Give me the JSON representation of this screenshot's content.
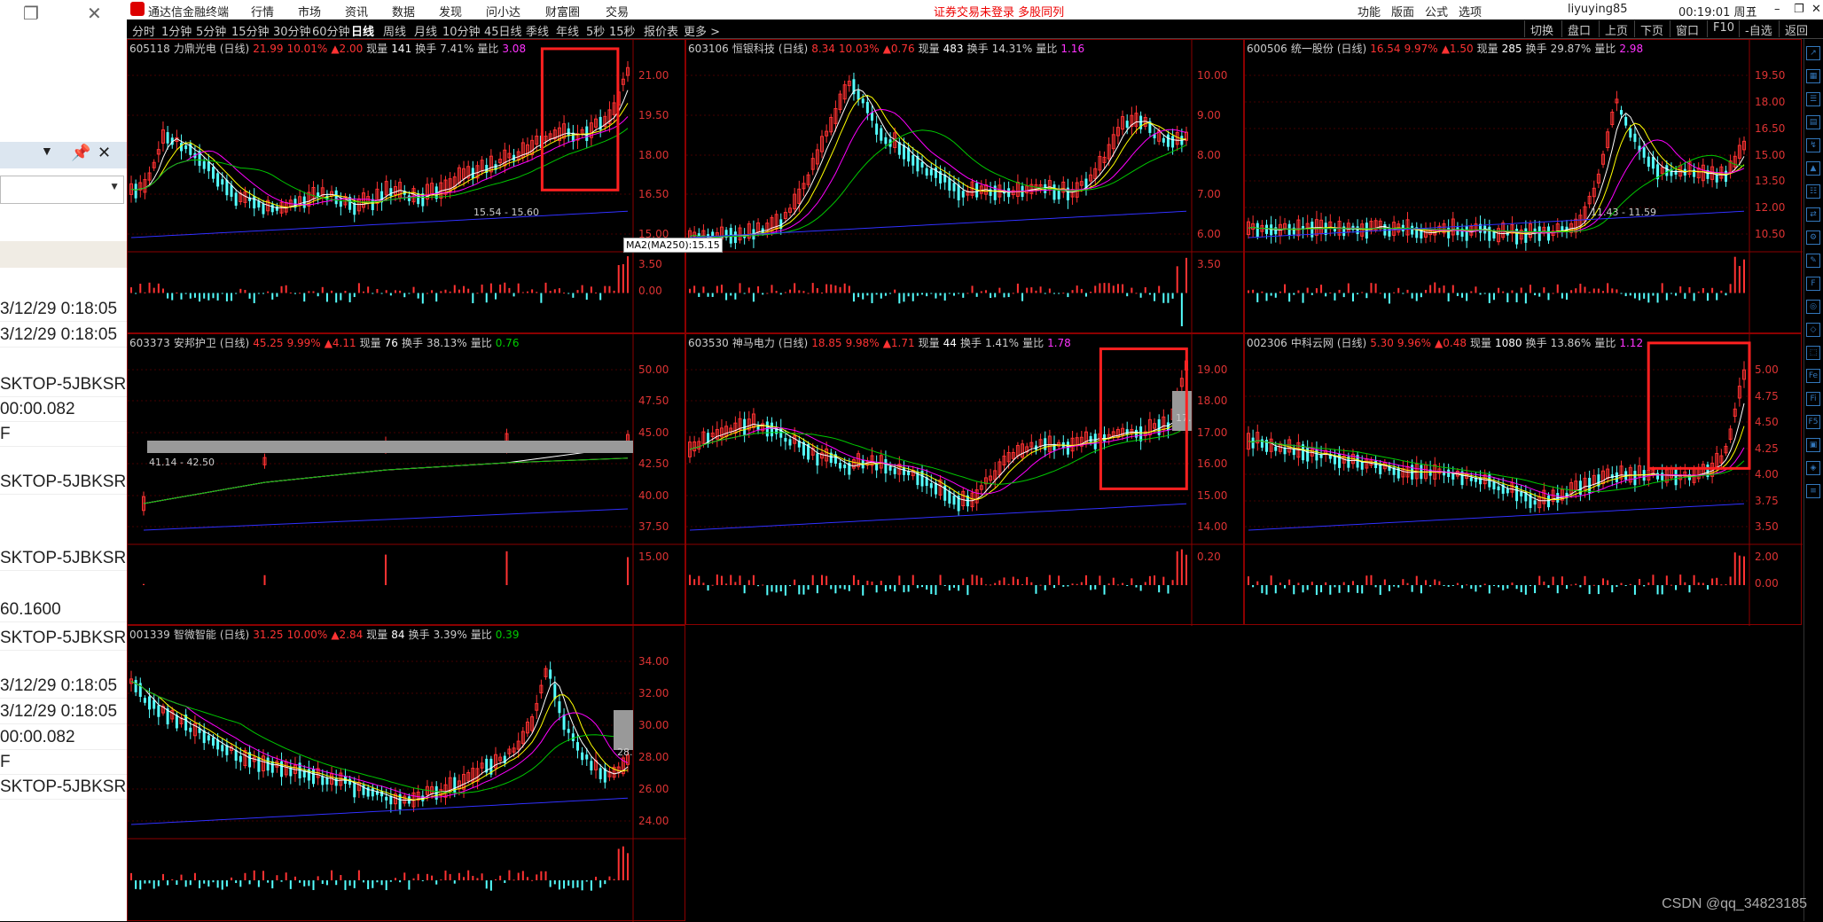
{
  "left_pane": {
    "rows": [
      "3/12/29 0:18:05",
      "3/12/29 0:18:05",
      "SKTOP-5JBKSRE",
      "00:00.082",
      "F",
      "SKTOP-5JBKSRE",
      "SKTOP-5JBKSRE\\",
      "60.1600",
      "SKTOP-5JBKSRE",
      "3/12/29 0:18:05",
      "3/12/29 0:18:05",
      "00:00.082",
      "F",
      "SKTOP-5JBKSRE"
    ]
  },
  "titlebar": {
    "app_name": "通达信金融终端",
    "menu": [
      "行情",
      "市场",
      "资讯",
      "数据",
      "发现",
      "问小达",
      "财富圈",
      "交易"
    ],
    "warning": "证券交易未登录  多股同列",
    "right_menu": [
      "功能",
      "版面",
      "公式",
      "选项"
    ],
    "user": "liyuying85",
    "clock": "00:19:01 周五"
  },
  "toolbar": {
    "periods": [
      "分时",
      "1分钟",
      "5分钟",
      "15分钟",
      "30分钟",
      "60分钟",
      "日线",
      "周线",
      "月线",
      "10分钟",
      "45日线",
      "季线",
      "年线",
      "5秒",
      "15秒",
      "报价表",
      "更多 >"
    ],
    "selected": "日线",
    "right_buttons": [
      "切换",
      "盘口",
      "上页",
      "下页",
      "窗口",
      "F10",
      "-自选",
      "返回"
    ]
  },
  "panels": [
    {
      "code": "605118",
      "name": "力鼎光电",
      "period": "(日线)",
      "price": "21.99",
      "pct": "10.01%",
      "chg": "▲2.00",
      "vol_label": "现量",
      "vol": "141",
      "turn_label": "换手",
      "turn": "7.41%",
      "ratio_label": "量比",
      "ratio": "3.08",
      "price_ticks": [
        "21.00",
        "19.50",
        "18.00",
        "16.50",
        "15.00"
      ],
      "vol_ticks": [
        "3.50",
        "0.00"
      ],
      "range_label": "15.54 - 15.60",
      "highlight": true
    },
    {
      "code": "603106",
      "name": "恒银科技",
      "period": "(日线)",
      "price": "8.34",
      "pct": "10.03%",
      "chg": "▲0.76",
      "vol_label": "现量",
      "vol": "483",
      "turn_label": "换手",
      "turn": "14.31%",
      "ratio_label": "量比",
      "ratio": "1.16",
      "price_ticks": [
        "10.00",
        "9.00",
        "8.00",
        "7.00",
        "6.00"
      ],
      "vol_ticks": [
        "3.50"
      ],
      "range_label": "",
      "highlight": false
    },
    {
      "code": "600506",
      "name": "统一股份",
      "period": "(日线)",
      "price": "16.54",
      "pct": "9.97%",
      "chg": "▲1.50",
      "vol_label": "现量",
      "vol": "285",
      "turn_label": "换手",
      "turn": "29.87%",
      "ratio_label": "量比",
      "ratio": "2.98",
      "price_ticks": [
        "19.50",
        "18.00",
        "16.50",
        "15.00",
        "13.50",
        "12.00",
        "10.50"
      ],
      "vol_ticks": [],
      "range_label": "11.43 - 11.59",
      "highlight": false
    },
    {
      "code": "603373",
      "name": "安邦护卫",
      "period": "(日线)",
      "price": "45.25",
      "pct": "9.99%",
      "chg": "▲4.11",
      "vol_label": "现量",
      "vol": "76",
      "turn_label": "换手",
      "turn": "38.13%",
      "ratio_label": "量比",
      "ratio": "0.76",
      "price_ticks": [
        "50.00",
        "47.50",
        "45.00",
        "42.50",
        "40.00",
        "37.50"
      ],
      "vol_ticks": [
        "15.00"
      ],
      "range_label": "41.14 - 42.50",
      "highlight": false
    },
    {
      "code": "603530",
      "name": "神马电力",
      "period": "(日线)",
      "price": "18.85",
      "pct": "9.98%",
      "chg": "▲1.71",
      "vol_label": "现量",
      "vol": "44",
      "turn_label": "换手",
      "turn": "1.41%",
      "ratio_label": "量比",
      "ratio": "1.78",
      "price_ticks": [
        "19.00",
        "18.00",
        "17.00",
        "16.00",
        "15.00",
        "14.00"
      ],
      "vol_ticks": [
        "0.20"
      ],
      "range_label": "17.",
      "highlight": true
    },
    {
      "code": "002306",
      "name": "中科云网",
      "period": "(日线)",
      "price": "5.30",
      "pct": "9.96%",
      "chg": "▲0.48",
      "vol_label": "现量",
      "vol": "1080",
      "turn_label": "换手",
      "turn": "13.86%",
      "ratio_label": "量比",
      "ratio": "1.12",
      "price_ticks": [
        "5.00",
        "4.75",
        "4.50",
        "4.25",
        "4.00",
        "3.75",
        "3.50"
      ],
      "vol_ticks": [
        "2.00",
        "0.00"
      ],
      "range_label": "",
      "highlight": true
    },
    {
      "code": "001339",
      "name": "智微智能",
      "period": "(日线)",
      "price": "31.25",
      "pct": "10.00%",
      "chg": "▲2.84",
      "vol_label": "现量",
      "vol": "84",
      "turn_label": "换手",
      "turn": "3.39%",
      "ratio_label": "量比",
      "ratio": "0.39",
      "price_ticks": [
        "34.00",
        "32.00",
        "30.00",
        "28.00",
        "26.00",
        "24.00"
      ],
      "vol_ticks": [],
      "range_label": "28.",
      "highlight": false
    }
  ],
  "tooltip": "MA2(MA250):15.15",
  "watermark": "CSDN @qq_34823185",
  "colors": {
    "up": "#ff3232",
    "down": "#54ffff",
    "ma5": "#ffffff",
    "ma10": "#ffff00",
    "ma20": "#ff00ff",
    "ma60": "#00c800",
    "ma250": "#3030ff",
    "highlight_box": "#ff2020"
  }
}
